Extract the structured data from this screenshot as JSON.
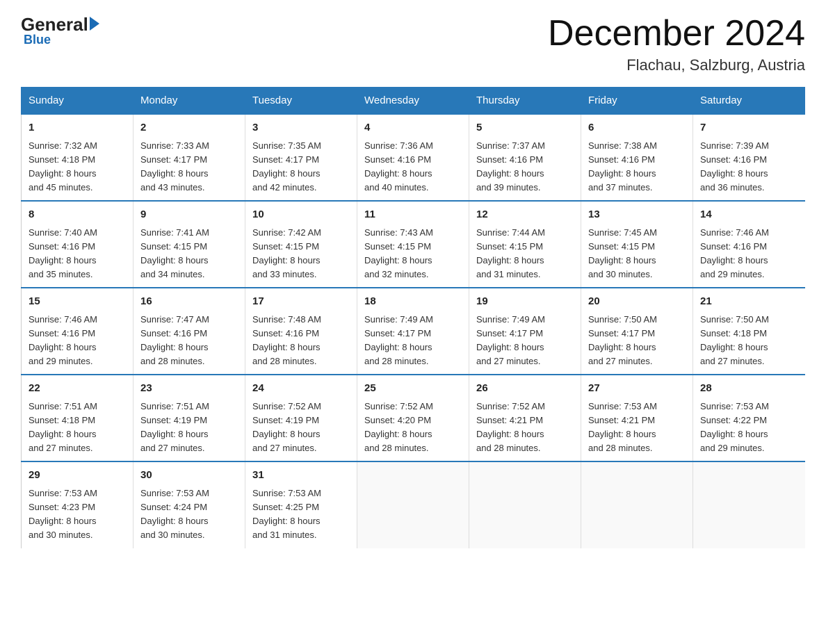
{
  "logo": {
    "general": "General",
    "blue": "Blue"
  },
  "header": {
    "month_year": "December 2024",
    "location": "Flachau, Salzburg, Austria"
  },
  "days_of_week": [
    "Sunday",
    "Monday",
    "Tuesday",
    "Wednesday",
    "Thursday",
    "Friday",
    "Saturday"
  ],
  "weeks": [
    [
      {
        "day": "1",
        "sunrise": "Sunrise: 7:32 AM",
        "sunset": "Sunset: 4:18 PM",
        "daylight": "Daylight: 8 hours and 45 minutes."
      },
      {
        "day": "2",
        "sunrise": "Sunrise: 7:33 AM",
        "sunset": "Sunset: 4:17 PM",
        "daylight": "Daylight: 8 hours and 43 minutes."
      },
      {
        "day": "3",
        "sunrise": "Sunrise: 7:35 AM",
        "sunset": "Sunset: 4:17 PM",
        "daylight": "Daylight: 8 hours and 42 minutes."
      },
      {
        "day": "4",
        "sunrise": "Sunrise: 7:36 AM",
        "sunset": "Sunset: 4:16 PM",
        "daylight": "Daylight: 8 hours and 40 minutes."
      },
      {
        "day": "5",
        "sunrise": "Sunrise: 7:37 AM",
        "sunset": "Sunset: 4:16 PM",
        "daylight": "Daylight: 8 hours and 39 minutes."
      },
      {
        "day": "6",
        "sunrise": "Sunrise: 7:38 AM",
        "sunset": "Sunset: 4:16 PM",
        "daylight": "Daylight: 8 hours and 37 minutes."
      },
      {
        "day": "7",
        "sunrise": "Sunrise: 7:39 AM",
        "sunset": "Sunset: 4:16 PM",
        "daylight": "Daylight: 8 hours and 36 minutes."
      }
    ],
    [
      {
        "day": "8",
        "sunrise": "Sunrise: 7:40 AM",
        "sunset": "Sunset: 4:16 PM",
        "daylight": "Daylight: 8 hours and 35 minutes."
      },
      {
        "day": "9",
        "sunrise": "Sunrise: 7:41 AM",
        "sunset": "Sunset: 4:15 PM",
        "daylight": "Daylight: 8 hours and 34 minutes."
      },
      {
        "day": "10",
        "sunrise": "Sunrise: 7:42 AM",
        "sunset": "Sunset: 4:15 PM",
        "daylight": "Daylight: 8 hours and 33 minutes."
      },
      {
        "day": "11",
        "sunrise": "Sunrise: 7:43 AM",
        "sunset": "Sunset: 4:15 PM",
        "daylight": "Daylight: 8 hours and 32 minutes."
      },
      {
        "day": "12",
        "sunrise": "Sunrise: 7:44 AM",
        "sunset": "Sunset: 4:15 PM",
        "daylight": "Daylight: 8 hours and 31 minutes."
      },
      {
        "day": "13",
        "sunrise": "Sunrise: 7:45 AM",
        "sunset": "Sunset: 4:15 PM",
        "daylight": "Daylight: 8 hours and 30 minutes."
      },
      {
        "day": "14",
        "sunrise": "Sunrise: 7:46 AM",
        "sunset": "Sunset: 4:16 PM",
        "daylight": "Daylight: 8 hours and 29 minutes."
      }
    ],
    [
      {
        "day": "15",
        "sunrise": "Sunrise: 7:46 AM",
        "sunset": "Sunset: 4:16 PM",
        "daylight": "Daylight: 8 hours and 29 minutes."
      },
      {
        "day": "16",
        "sunrise": "Sunrise: 7:47 AM",
        "sunset": "Sunset: 4:16 PM",
        "daylight": "Daylight: 8 hours and 28 minutes."
      },
      {
        "day": "17",
        "sunrise": "Sunrise: 7:48 AM",
        "sunset": "Sunset: 4:16 PM",
        "daylight": "Daylight: 8 hours and 28 minutes."
      },
      {
        "day": "18",
        "sunrise": "Sunrise: 7:49 AM",
        "sunset": "Sunset: 4:17 PM",
        "daylight": "Daylight: 8 hours and 28 minutes."
      },
      {
        "day": "19",
        "sunrise": "Sunrise: 7:49 AM",
        "sunset": "Sunset: 4:17 PM",
        "daylight": "Daylight: 8 hours and 27 minutes."
      },
      {
        "day": "20",
        "sunrise": "Sunrise: 7:50 AM",
        "sunset": "Sunset: 4:17 PM",
        "daylight": "Daylight: 8 hours and 27 minutes."
      },
      {
        "day": "21",
        "sunrise": "Sunrise: 7:50 AM",
        "sunset": "Sunset: 4:18 PM",
        "daylight": "Daylight: 8 hours and 27 minutes."
      }
    ],
    [
      {
        "day": "22",
        "sunrise": "Sunrise: 7:51 AM",
        "sunset": "Sunset: 4:18 PM",
        "daylight": "Daylight: 8 hours and 27 minutes."
      },
      {
        "day": "23",
        "sunrise": "Sunrise: 7:51 AM",
        "sunset": "Sunset: 4:19 PM",
        "daylight": "Daylight: 8 hours and 27 minutes."
      },
      {
        "day": "24",
        "sunrise": "Sunrise: 7:52 AM",
        "sunset": "Sunset: 4:19 PM",
        "daylight": "Daylight: 8 hours and 27 minutes."
      },
      {
        "day": "25",
        "sunrise": "Sunrise: 7:52 AM",
        "sunset": "Sunset: 4:20 PM",
        "daylight": "Daylight: 8 hours and 28 minutes."
      },
      {
        "day": "26",
        "sunrise": "Sunrise: 7:52 AM",
        "sunset": "Sunset: 4:21 PM",
        "daylight": "Daylight: 8 hours and 28 minutes."
      },
      {
        "day": "27",
        "sunrise": "Sunrise: 7:53 AM",
        "sunset": "Sunset: 4:21 PM",
        "daylight": "Daylight: 8 hours and 28 minutes."
      },
      {
        "day": "28",
        "sunrise": "Sunrise: 7:53 AM",
        "sunset": "Sunset: 4:22 PM",
        "daylight": "Daylight: 8 hours and 29 minutes."
      }
    ],
    [
      {
        "day": "29",
        "sunrise": "Sunrise: 7:53 AM",
        "sunset": "Sunset: 4:23 PM",
        "daylight": "Daylight: 8 hours and 30 minutes."
      },
      {
        "day": "30",
        "sunrise": "Sunrise: 7:53 AM",
        "sunset": "Sunset: 4:24 PM",
        "daylight": "Daylight: 8 hours and 30 minutes."
      },
      {
        "day": "31",
        "sunrise": "Sunrise: 7:53 AM",
        "sunset": "Sunset: 4:25 PM",
        "daylight": "Daylight: 8 hours and 31 minutes."
      },
      null,
      null,
      null,
      null
    ]
  ]
}
